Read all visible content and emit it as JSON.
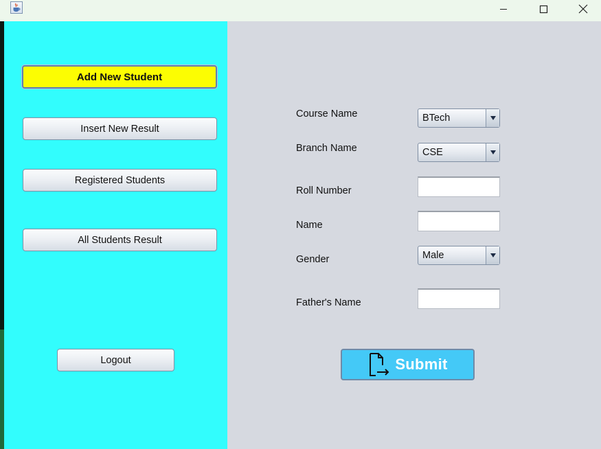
{
  "window": {
    "icons": {
      "app": "java-cup-icon",
      "minimize": "minimize-icon",
      "maximize": "maximize-icon",
      "close": "close-icon"
    }
  },
  "sidebar": {
    "add_new_student": "Add New Student",
    "insert_new_result": "Insert New Result",
    "registered_students": "Registered Students",
    "all_students_result": "All Students Result",
    "logout": "Logout"
  },
  "form": {
    "course_label": "Course Name",
    "course_value": "BTech",
    "branch_label": "Branch Name",
    "branch_value": "CSE",
    "roll_label": "Roll Number",
    "roll_value": "",
    "name_label": "Name",
    "name_value": "",
    "gender_label": "Gender",
    "gender_value": "Male",
    "father_label": "Father's Name",
    "father_value": "",
    "submit_label": "Submit",
    "submit_icon": "document-export-icon"
  },
  "colors": {
    "sidebar_bg": "#32fdfd",
    "main_bg": "#d6d9e0",
    "active_button": "#fcfd02",
    "submit_bg": "#44c9f7"
  }
}
